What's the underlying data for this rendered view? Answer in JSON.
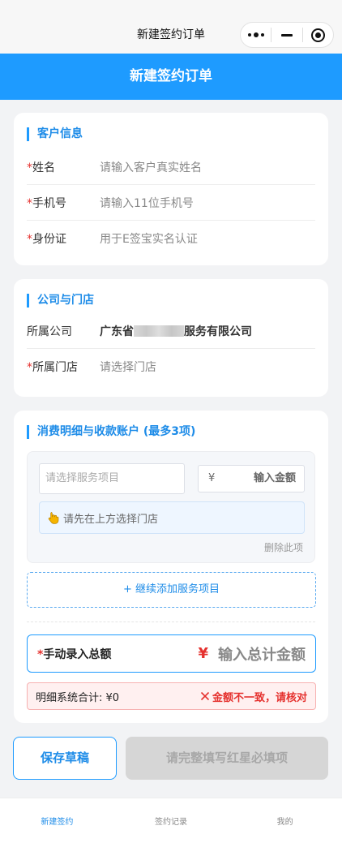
{
  "window": {
    "title": "新建签约订单"
  },
  "header": {
    "title": "新建签约订单"
  },
  "customer": {
    "section_title": "客户信息",
    "req_mark": "*",
    "name_label": "姓名",
    "name_placeholder": "请输入客户真实姓名",
    "phone_label": "手机号",
    "phone_placeholder": "请输入11位手机号",
    "id_label": "身份证",
    "id_placeholder": "用于E签宝实名认证"
  },
  "company": {
    "section_title": "公司与门店",
    "company_label": "所属公司",
    "company_prefix": "广东省",
    "company_suffix": "服务有限公司",
    "store_label": "所属门店",
    "store_placeholder": "请选择门店"
  },
  "items": {
    "section_title": "消费明细与收款账户 (最多3项)",
    "service_placeholder": "请选择服务项目",
    "currency": "¥",
    "amount_placeholder": "输入金额",
    "tip": "请先在上方选择门店",
    "delete_label": "删除此项",
    "add_label": "+ 继续添加服务项目",
    "total_label": "手动录入总额",
    "total_currency": "¥",
    "total_placeholder": "输入总计金额",
    "system_total": "明细系统合计: ¥0",
    "mismatch": "金额不一致，请核对"
  },
  "actions": {
    "draft_label": "保存草稿",
    "submit_label": "请完整填写红星必填项"
  },
  "tabbar": {
    "tabs": [
      "新建签约",
      "签约记录",
      "我的"
    ]
  },
  "colors": {
    "primary": "#1e9bff",
    "danger": "#e5312e",
    "background": "#f2f3f5"
  }
}
